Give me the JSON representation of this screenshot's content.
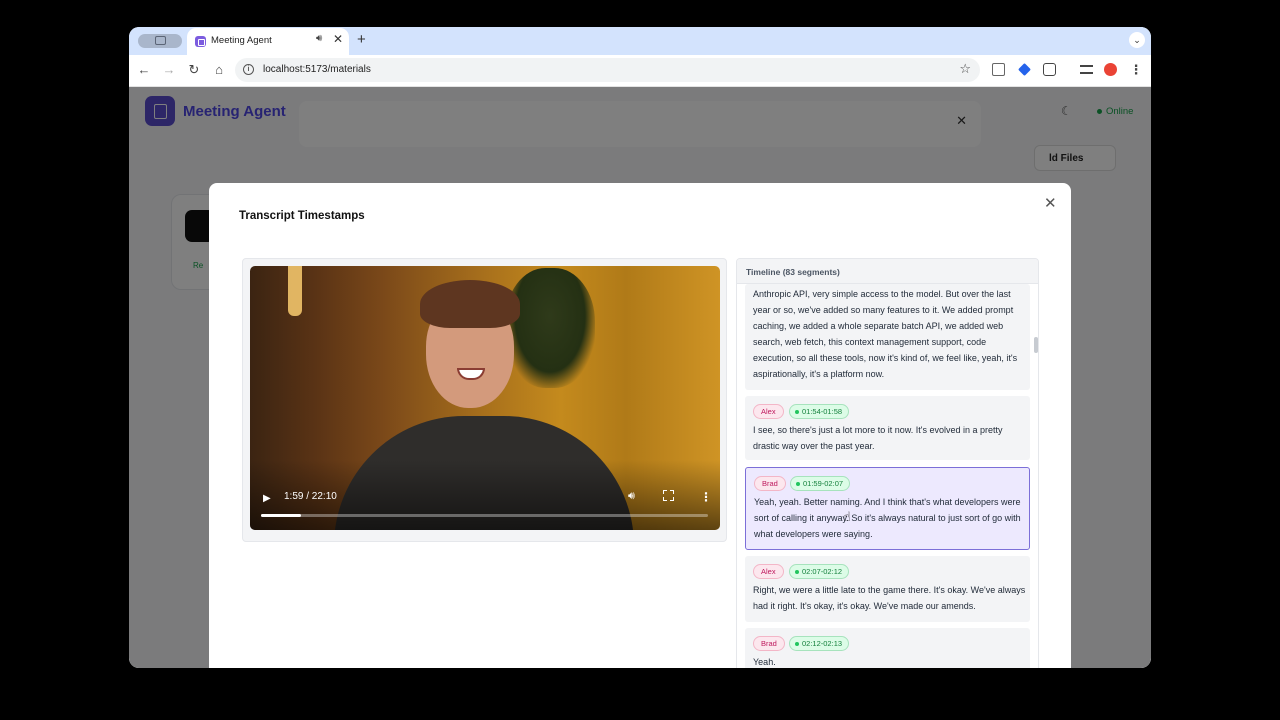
{
  "browser": {
    "tab_title": "Meeting Agent",
    "url": "localhost:5173/materials",
    "new_tab_glyph": "+",
    "close_glyph": "✕"
  },
  "app": {
    "title": "Meeting Agent",
    "status": "Online",
    "add_files": "ld Files",
    "card_tag": "Re"
  },
  "modal": {
    "title": "Transcript Timestamps",
    "close_glyph": "✕"
  },
  "video": {
    "time": "1:59 / 22:10",
    "progress_fraction": 0.09
  },
  "timeline": {
    "header": "Timeline (83 segments)",
    "segments": [
      {
        "text": "Anthropic API, very simple access to the model. But over the last year or so, we've added so many features to it. We added prompt caching, we added a whole separate batch API, we added web search, web fetch, this context management support, code execution, so all these tools, now it's kind of, we feel like, yeah, it's aspirationally, it's a platform now."
      },
      {
        "speaker": "Alex",
        "time": "01:54-01:58",
        "text": "I see, so there's just a lot more to it now. It's evolved in a pretty drastic way over the past year."
      },
      {
        "speaker": "Brad",
        "time": "01:59-02:07",
        "text": "Yeah, yeah. Better naming. And I think that's what developers were sort of calling it anyway. So it's always natural to just sort of go with what developers were saying."
      },
      {
        "speaker": "Alex",
        "time": "02:07-02:12",
        "text": "Right, we were a little late to the game there. It's okay. We've always had it right. It's okay, it's okay. We've made our amends."
      },
      {
        "speaker": "Brad",
        "time": "02:12-02:13",
        "text": "Yeah."
      }
    ]
  },
  "icons": {
    "back": "back-arrow-icon",
    "forward": "forward-arrow-icon",
    "reload": "reload-icon",
    "home": "home-icon",
    "play": "play-icon",
    "volume": "volume-icon",
    "fullscreen": "fullscreen-icon",
    "more": "more-vertical-icon"
  },
  "colors": {
    "accent": "#4f46e5",
    "active_segment": "#ede9fe",
    "speaker_badge": "#fce7ee",
    "time_badge": "#dcfce7"
  }
}
